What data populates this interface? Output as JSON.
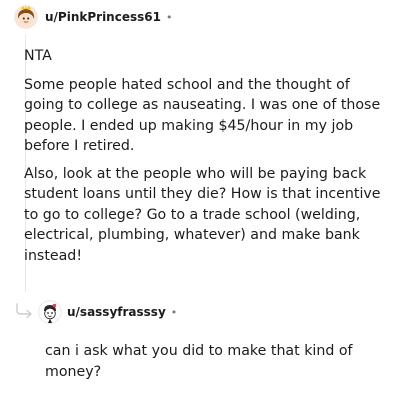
{
  "comment": {
    "username": "u/PinkPrincess61",
    "separator": "•",
    "avatar_icon": "snoo-avatar-icon",
    "paragraphs": [
      "NTA",
      "Some people hated school and the thought of going to college as nauseating. I was one of those people. I ended up making $45/hour in my job before I retired.",
      "Also, look at the people who will be paying back student loans until they die? How is that incentive to go to college? Go to a trade school (welding, electrical, plumbing, whatever) and make bank instead!"
    ]
  },
  "reply": {
    "username": "u/sassyfrasssy",
    "separator": "•",
    "avatar_icon": "snoo-avatar-icon",
    "arrow_icon": "reply-arrow-icon",
    "paragraphs": [
      "can i ask what you did to make that kind of money?"
    ]
  }
}
